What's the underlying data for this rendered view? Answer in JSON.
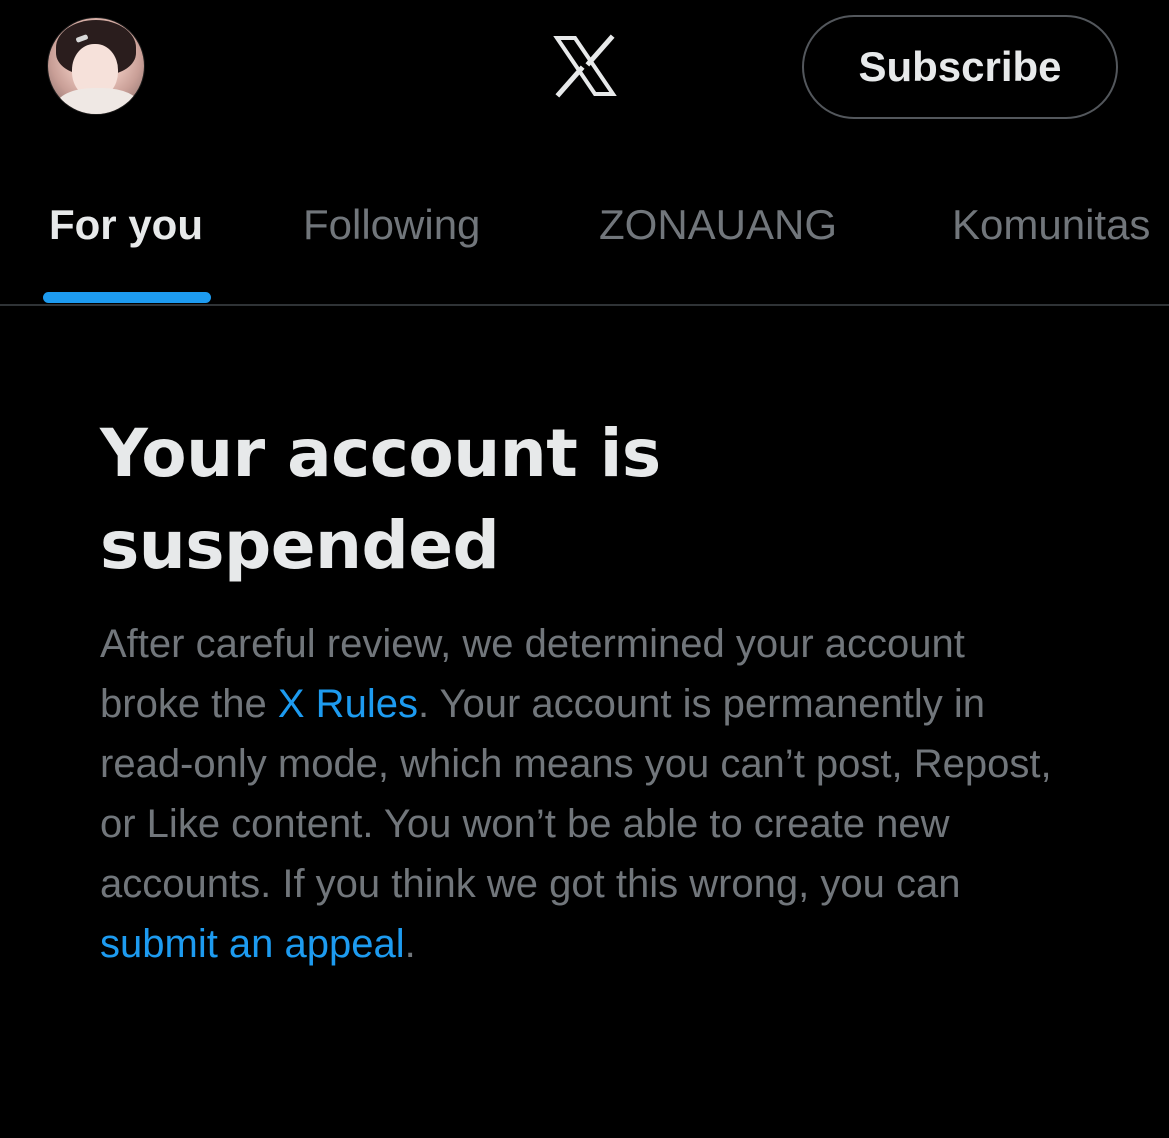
{
  "header": {
    "avatar_alt": "profile picture",
    "logo_icon": "x-logo-icon",
    "subscribe_label": "Subscribe"
  },
  "tabs": [
    {
      "label": "For you",
      "active": true
    },
    {
      "label": "Following",
      "active": false
    },
    {
      "label": "ZONAUANG",
      "active": false
    },
    {
      "label": "Komunitas",
      "active": false
    }
  ],
  "notice": {
    "title": "Your account is suspended",
    "text_1": "After careful review, we determined your account broke the ",
    "rules_link": "X Rules",
    "text_2": ". Your account is permanently in read-only mode, which means you can’t post, Repost, or Like content. You won’t be able to create new accounts. If you think we got this wrong, you can ",
    "appeal_link": "submit an appeal",
    "text_3": "."
  },
  "colors": {
    "background": "#000000",
    "primary_text": "#e7e9ea",
    "secondary_text": "#71767b",
    "accent": "#1d9bf0",
    "border": "#2f3336"
  }
}
